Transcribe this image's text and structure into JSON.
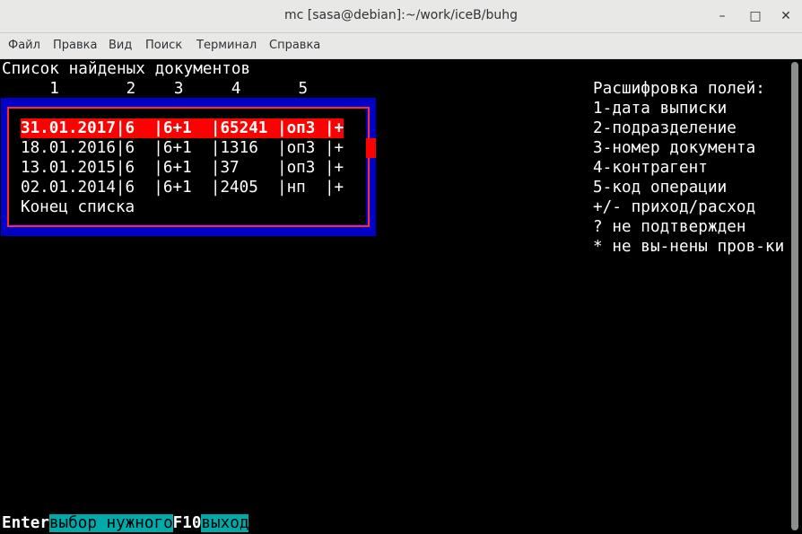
{
  "window": {
    "title": "mc [sasa@debian]:~/work/iceB/buhg",
    "minimize_glyph": "–",
    "maximize_glyph": "□",
    "close_glyph": "✕"
  },
  "menu": {
    "items": [
      "Файл",
      "Правка",
      "Вид",
      "Поиск",
      "Терминал",
      "Справка"
    ]
  },
  "screen": {
    "heading": "Список найденых документов",
    "column_numbers": "     1       2    3     4      5",
    "documents": [
      {
        "date": "31.01.2017",
        "dept": "6",
        "number": "6+1",
        "contractor": "65241",
        "op": "оп3",
        "sign": "+",
        "text": "31.01.2017|6  |6+1  |65241 |оп3 |+"
      },
      {
        "date": "18.01.2016",
        "dept": "6",
        "number": "6+1",
        "contractor": "1316",
        "op": "оп3",
        "sign": "+",
        "text": "18.01.2016|6  |6+1  |1316  |оп3 |+"
      },
      {
        "date": "13.01.2015",
        "dept": "6",
        "number": "6+1",
        "contractor": "37",
        "op": "оп3",
        "sign": "+",
        "text": "13.01.2015|6  |6+1  |37    |оп3 |+"
      },
      {
        "date": "02.01.2014",
        "dept": "6",
        "number": "6+1",
        "contractor": "2405",
        "op": "нп",
        "sign": "+",
        "text": "02.01.2014|6  |6+1  |2405  |нп  |+"
      }
    ],
    "list_end": "Конец списка",
    "legend": [
      "Расшифровка полей:",
      "1-дата выписки",
      "2-подразделение",
      "3-номер документа",
      "4-контрагент",
      "5-код операции",
      "+/- приход/расход",
      "? не подтвержден",
      "* не вы-нены пров-ки"
    ]
  },
  "keybar": [
    {
      "key": "Enter",
      "desc": "выбор нужного"
    },
    {
      "key": "F10",
      "desc": "выход"
    }
  ],
  "colors": {
    "panel_blue": "#0000c8",
    "frame_red": "#ff2a2a",
    "selection_red": "#ff0000",
    "key_desc_cyan": "#00aaaa"
  }
}
